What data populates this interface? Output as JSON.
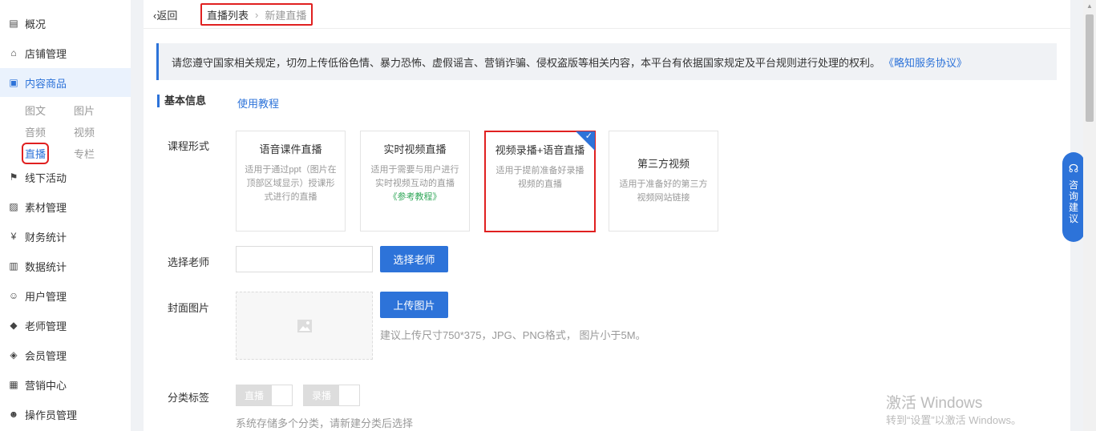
{
  "sidebar": {
    "items": [
      {
        "label": "概况",
        "icon": "overview-icon",
        "glyph": "▤"
      },
      {
        "label": "店铺管理",
        "icon": "store-icon",
        "glyph": "⌂"
      },
      {
        "label": "内容商品",
        "icon": "content-bag-icon",
        "glyph": "▣",
        "active": true
      },
      {
        "label": "线下活动",
        "icon": "flag-icon",
        "glyph": "⚑"
      },
      {
        "label": "素材管理",
        "icon": "image-icon",
        "glyph": "▨"
      },
      {
        "label": "财务统计",
        "icon": "money-shield-icon",
        "glyph": "¥"
      },
      {
        "label": "数据统计",
        "icon": "bar-chart-icon",
        "glyph": "▥"
      },
      {
        "label": "用户管理",
        "icon": "user-icon",
        "glyph": "☺"
      },
      {
        "label": "老师管理",
        "icon": "graduation-cap-icon",
        "glyph": "◆"
      },
      {
        "label": "会员管理",
        "icon": "member-diamond-icon",
        "glyph": "◈"
      },
      {
        "label": "营销中心",
        "icon": "marketing-icon",
        "glyph": "▦"
      },
      {
        "label": "操作员管理",
        "icon": "operator-icon",
        "glyph": "☻"
      }
    ],
    "sub_items": [
      "图文",
      "图片",
      "音频",
      "视频",
      "直播",
      "专栏"
    ],
    "current_sub": "直播"
  },
  "header": {
    "back_label": "返回",
    "breadcrumb": [
      "直播列表",
      "新建直播"
    ]
  },
  "notice": {
    "text": "请您遵守国家相关规定，切勿上传低俗色情、暴力恐怖、虚假谣言、营销诈骗、侵权盗版等相关内容，本平台有依据国家规定及平台规则进行处理的权利。",
    "link": "《略知服务协议》"
  },
  "section": {
    "title": "基本信息",
    "tutorial_link": "使用教程"
  },
  "form": {
    "course_form_label": "课程形式",
    "course_cards": [
      {
        "title": "语音课件直播",
        "desc": "适用于通过ppt（图片在顶部区域显示）授课形式进行的直播",
        "link": ""
      },
      {
        "title": "实时视频直播",
        "desc": "适用于需要与用户进行实时视频互动的直播",
        "link": "《参考教程》"
      },
      {
        "title": "视频录播+语音直播",
        "desc": "适用于提前准备好录播视频的直播",
        "link": "",
        "selected": true
      },
      {
        "title": "第三方视频",
        "desc": "适用于准备好的第三方视频网站链接",
        "link": ""
      }
    ],
    "teacher_label": "选择老师",
    "teacher_value": "",
    "teacher_button": "选择老师",
    "cover_label": "封面图片",
    "upload_button": "上传图片",
    "upload_hint": "建议上传尺寸750*375，JPG、PNG格式， 图片小于5M。",
    "tags_label": "分类标签",
    "tags": [
      "直播",
      "录播"
    ],
    "tags_hint": "系统存储多个分类，请新建分类后选择"
  },
  "consult": {
    "label": "咨询建议"
  },
  "watermark": {
    "line1": "激活 Windows",
    "line2": "转到“设置”以激活 Windows。"
  }
}
